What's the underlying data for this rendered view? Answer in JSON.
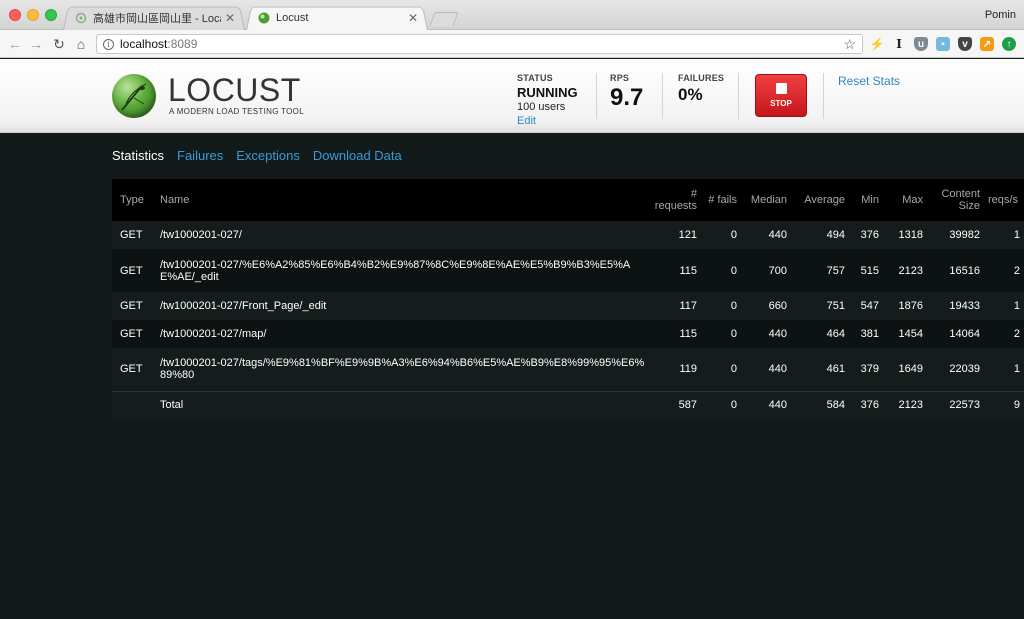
{
  "browser": {
    "tabs": [
      {
        "title": "高雄市岡山區岡山里 - LocalWiki",
        "active": false
      },
      {
        "title": "Locust",
        "active": true
      }
    ],
    "profile": "Pomin",
    "url_host": "localhost",
    "url_port": ":8089"
  },
  "header": {
    "logo_text": "LOCUST",
    "logo_tagline": "A MODERN LOAD TESTING TOOL",
    "status_label": "STATUS",
    "status_value": "RUNNING",
    "status_users": "100 users",
    "edit_label": "Edit",
    "rps_label": "RPS",
    "rps_value": "9.7",
    "failures_label": "FAILURES",
    "failures_value": "0%",
    "stop_label": "STOP",
    "reset_label": "Reset Stats"
  },
  "nav": [
    "Statistics",
    "Failures",
    "Exceptions",
    "Download Data"
  ],
  "table": {
    "columns": [
      "Type",
      "Name",
      "# requests",
      "# fails",
      "Median",
      "Average",
      "Min",
      "Max",
      "Content Size",
      "reqs/s"
    ],
    "rows": [
      {
        "type": "GET",
        "name": "/tw1000201-027/",
        "requests": "121",
        "fails": "0",
        "median": "440",
        "average": "494",
        "min": "376",
        "max": "1318",
        "size": "39982",
        "rps": "1"
      },
      {
        "type": "GET",
        "name": "/tw1000201-027/%E6%A2%85%E6%B4%B2%E9%87%8C%E9%8E%AE%E5%B9%B3%E5%AE%AE/_edit",
        "requests": "115",
        "fails": "0",
        "median": "700",
        "average": "757",
        "min": "515",
        "max": "2123",
        "size": "16516",
        "rps": "2"
      },
      {
        "type": "GET",
        "name": "/tw1000201-027/Front_Page/_edit",
        "requests": "117",
        "fails": "0",
        "median": "660",
        "average": "751",
        "min": "547",
        "max": "1876",
        "size": "19433",
        "rps": "1"
      },
      {
        "type": "GET",
        "name": "/tw1000201-027/map/",
        "requests": "115",
        "fails": "0",
        "median": "440",
        "average": "464",
        "min": "381",
        "max": "1454",
        "size": "14064",
        "rps": "2"
      },
      {
        "type": "GET",
        "name": "/tw1000201-027/tags/%E9%81%BF%E9%9B%A3%E6%94%B6%E5%AE%B9%E8%99%95%E6%89%80",
        "requests": "119",
        "fails": "0",
        "median": "440",
        "average": "461",
        "min": "379",
        "max": "1649",
        "size": "22039",
        "rps": "1"
      }
    ],
    "total": {
      "type": "",
      "name": "Total",
      "requests": "587",
      "fails": "0",
      "median": "440",
      "average": "584",
      "min": "376",
      "max": "2123",
      "size": "22573",
      "rps": "9"
    }
  },
  "colors": {
    "accent": "#2f86c4",
    "stop": "#d9232a",
    "background": "#121a1a"
  }
}
